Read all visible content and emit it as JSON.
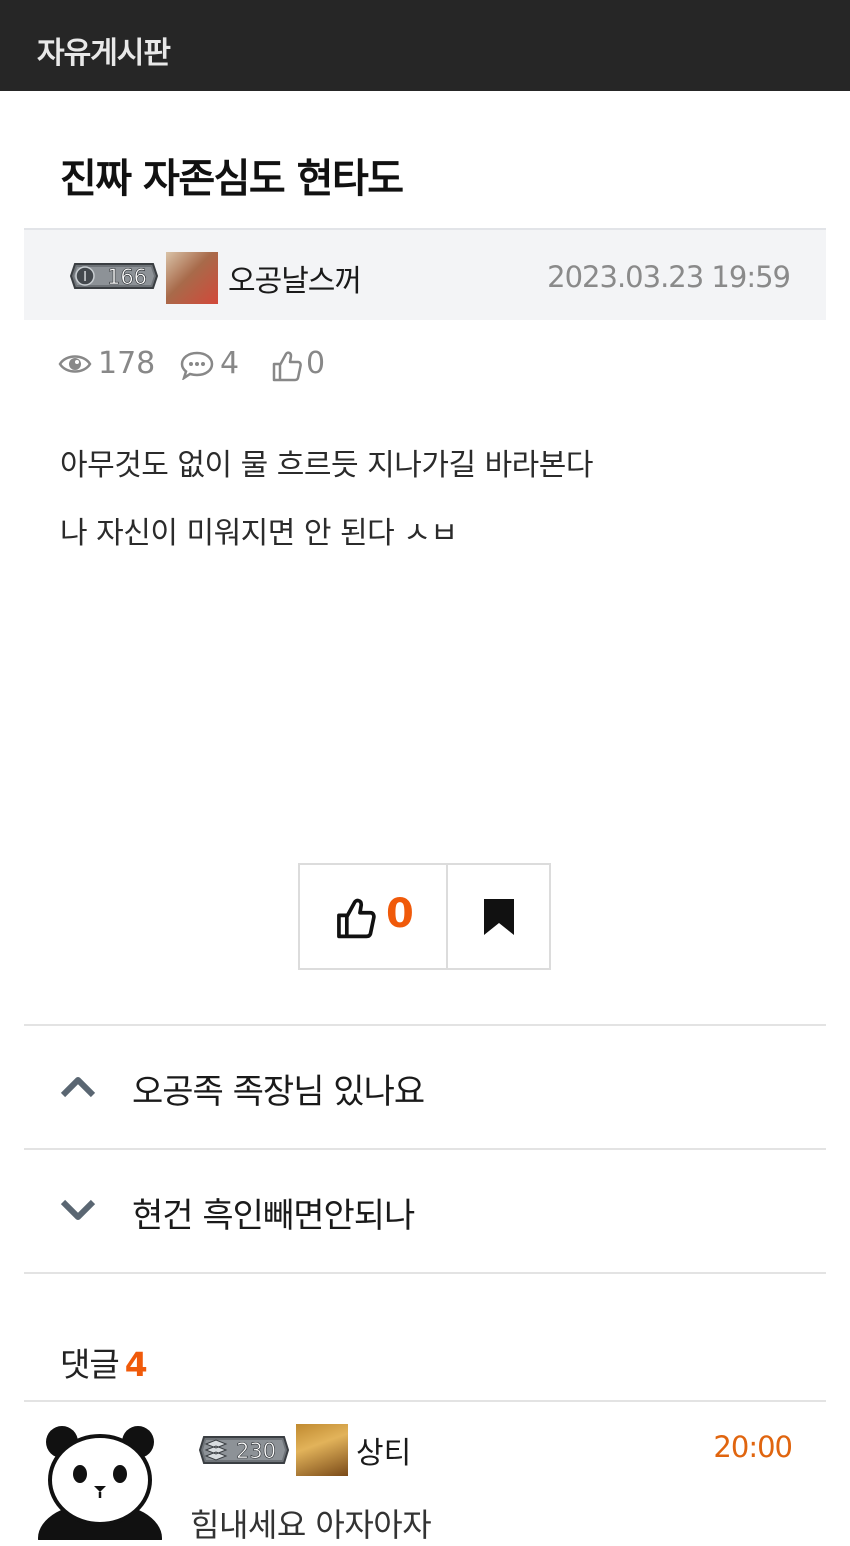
{
  "header": {
    "title": "자유게시판"
  },
  "post": {
    "title": "진짜 자존심도 현타도",
    "author": {
      "level": "166",
      "name": "오공날스꺼"
    },
    "date": "2023.03.23 19:59",
    "stats": {
      "views": "178",
      "comments": "4",
      "likes": "0"
    },
    "body": [
      "아무것도 없이 물 흐르듯 지나가길 바라본다",
      "나 자신이 미워지면 안 된다 ㅅㅂ"
    ],
    "actions": {
      "like_count": "0"
    }
  },
  "navigation": {
    "previous": {
      "icon": "chevron-up-icon",
      "title": "오공족 족장님 있나요"
    },
    "next": {
      "icon": "chevron-down-icon",
      "title": "현건 흑인빼면안되나"
    }
  },
  "comments": {
    "label": "댓글",
    "count": "4",
    "items": [
      {
        "level": "230",
        "name": "상티",
        "time": "20:00",
        "text": "힘내세요 아자아자"
      }
    ]
  },
  "colors": {
    "accent": "#f05a0a",
    "topbar": "#262626",
    "meta_bg": "#f3f4f6",
    "time": "#e0650f"
  }
}
